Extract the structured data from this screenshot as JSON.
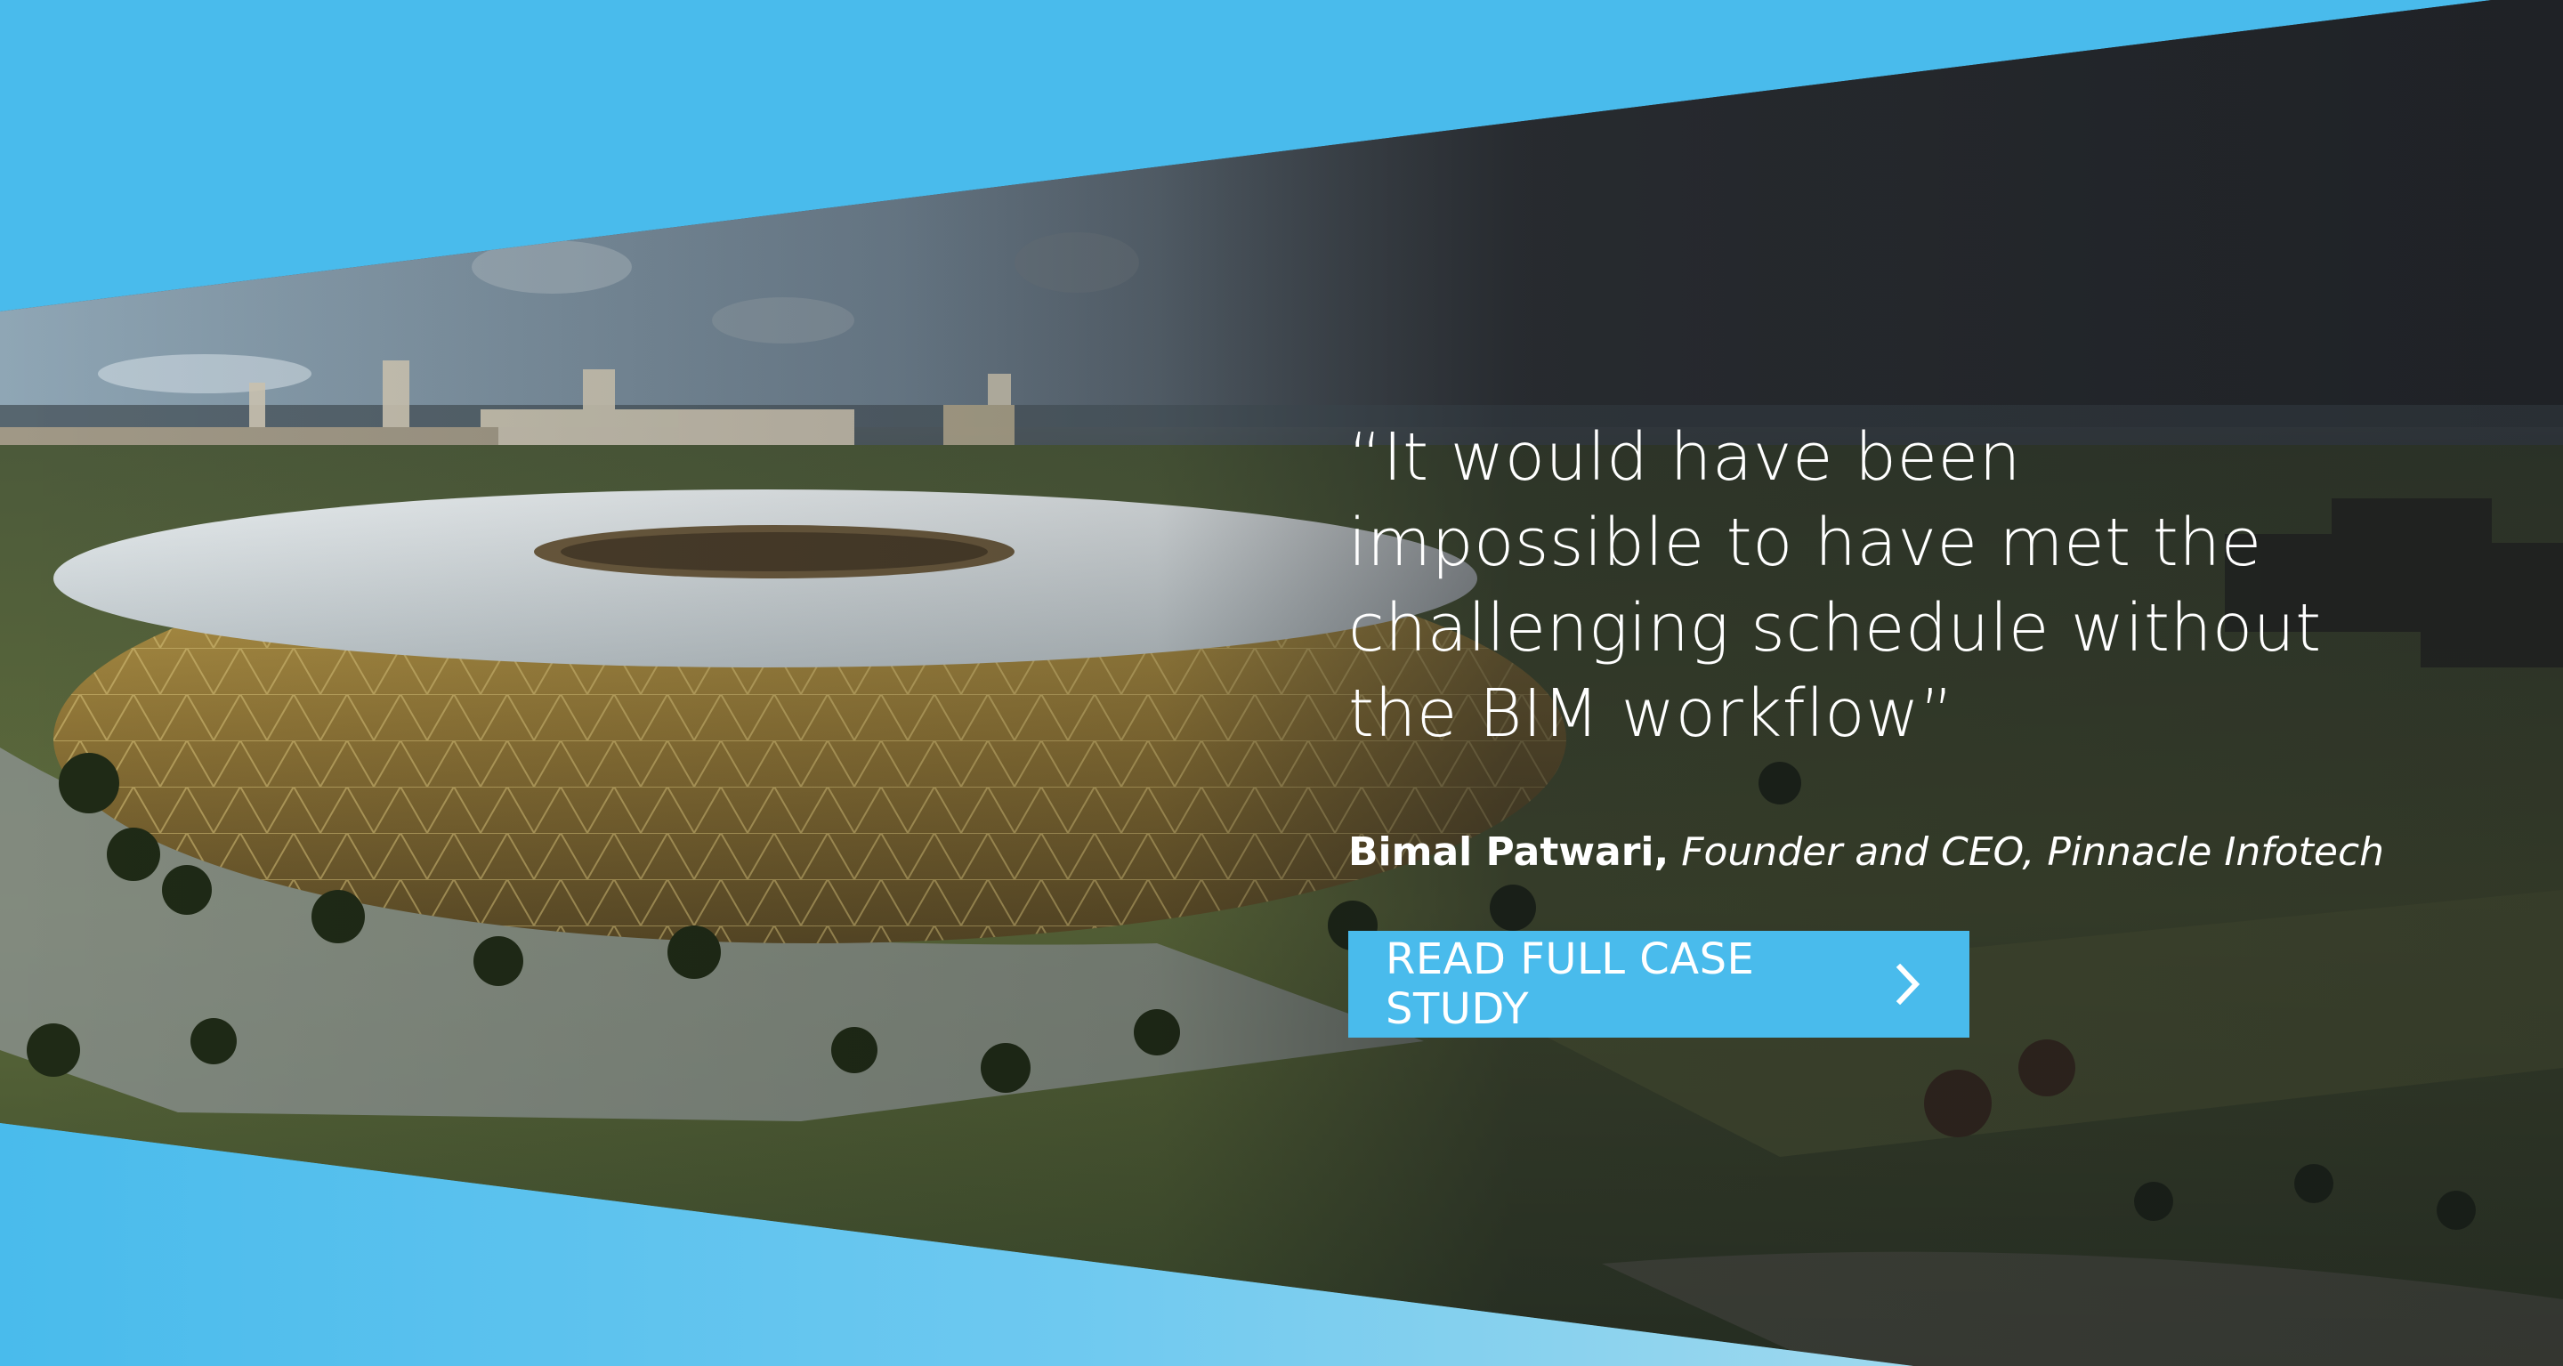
{
  "colors": {
    "accent_blue": "#49bbec",
    "text_white": "#ffffff"
  },
  "quote": {
    "text": "“It would have been\nimpossible to have met the\nchallenging schedule without\nthe BIM workflow”"
  },
  "attribution": {
    "name": "Bimal Patwari,",
    "role": "Founder and CEO, Pinnacle Infotech"
  },
  "cta": {
    "label": "READ FULL CASE STUDY",
    "icon": "chevron-right-icon"
  }
}
